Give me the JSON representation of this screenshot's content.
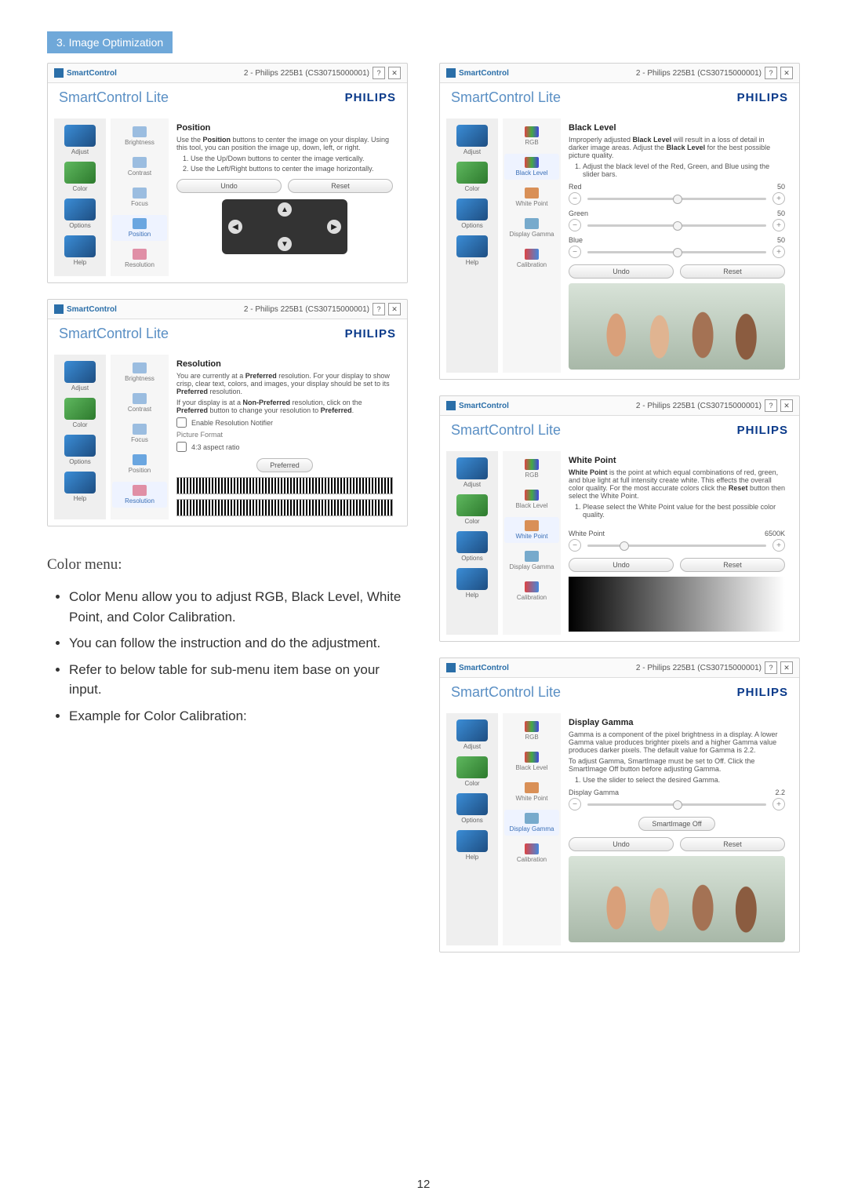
{
  "section_tag": "3. Image Optimization",
  "page_number": "12",
  "app_common": {
    "titlebar_name": "SmartControl",
    "titlebar_right": "2 - Philips 225B1 (CS30715000001)",
    "header_title": "SmartControl Lite",
    "logo": "PHILIPS",
    "help_icon": "?",
    "close_icon": "✕"
  },
  "sidebar": {
    "items": [
      {
        "label": "Adjust"
      },
      {
        "label": "Color"
      },
      {
        "label": "Options"
      },
      {
        "label": "Help"
      }
    ]
  },
  "adjust_sub": {
    "items": [
      {
        "label": "Brightness"
      },
      {
        "label": "Contrast"
      },
      {
        "label": "Focus"
      },
      {
        "label": "Position"
      },
      {
        "label": "Resolution"
      }
    ]
  },
  "color_sub": {
    "items": [
      {
        "label": "RGB"
      },
      {
        "label": "Black Level"
      },
      {
        "label": "White Point"
      },
      {
        "label": "Display Gamma"
      },
      {
        "label": "Calibration"
      }
    ]
  },
  "buttons": {
    "undo": "Undo",
    "reset": "Reset",
    "preferred": "Preferred",
    "si_off": "SmartImage Off"
  },
  "panels": {
    "position": {
      "title": "Position",
      "intro": "Use the Position buttons to center the image on your display. Using this tool, you can position the image up, down, left, or right.",
      "li1": "Use the Up/Down buttons to center the image vertically.",
      "li2": "Use the Left/Right buttons to center the image horizontally."
    },
    "resolution": {
      "title": "Resolution",
      "p1a": "You are currently at a ",
      "p1b": "Preferred",
      "p1c": " resolution. For your display to show crisp, clear text, colors, and images, your display should be set to its ",
      "p1d": "Preferred",
      "p1e": " resolution.",
      "p2a": "If your display is at a ",
      "p2b": "Non-Preferred",
      "p2c": " resolution, click on the ",
      "p2d": "Preferred",
      "p2e": " button to change your resolution to ",
      "p2f": "Preferred",
      "p2g": ".",
      "ck1": "Enable Resolution Notifier",
      "pf": "Picture Format",
      "ck2": "4:3 aspect ratio"
    },
    "blacklevel": {
      "title": "Black Level",
      "p1a": "Improperly adjusted ",
      "p1b": "Black Level",
      "p1c": " will result in a loss of detail in darker image areas. Adjust the ",
      "p1d": "Black Level",
      "p1e": " for the best possible picture quality.",
      "li1": "Adjust the black level of the Red, Green, and Blue using the slider bars.",
      "r": "Red",
      "g": "Green",
      "b": "Blue",
      "v": "50"
    },
    "whitepoint": {
      "title": "White Point",
      "p1a": "White Point",
      "p1b": " is the point at which equal combinations of red, green, and blue light at full intensity create white. This effects the overall color quality. For the most accurate colors click the ",
      "p1c": "Reset",
      "p1d": " button then select the White Point.",
      "li1": "Please select the White Point value for the best possible color quality.",
      "label": "White Point",
      "value": "6500K"
    },
    "gamma": {
      "title": "Display Gamma",
      "p1": "Gamma is a component of the pixel brightness in a display. A lower Gamma value produces brighter pixels and a higher Gamma value produces darker pixels. The default value for Gamma is 2.2.",
      "p2": "To adjust Gamma, SmartImage must be set to Off. Click the SmartImage Off button before adjusting Gamma.",
      "li1": "Use the slider to select the desired Gamma.",
      "label": "Display Gamma",
      "value": "2.2"
    }
  },
  "doc": {
    "heading": "Color menu:",
    "li1": "Color Menu allow you to adjust RGB, Black Level, White Point, and Color Calibration.",
    "li2": "You can follow the instruction and do the adjustment.",
    "li3": "Refer to below table for sub-menu item base on your input.",
    "li4": "Example for Color Calibration:"
  }
}
